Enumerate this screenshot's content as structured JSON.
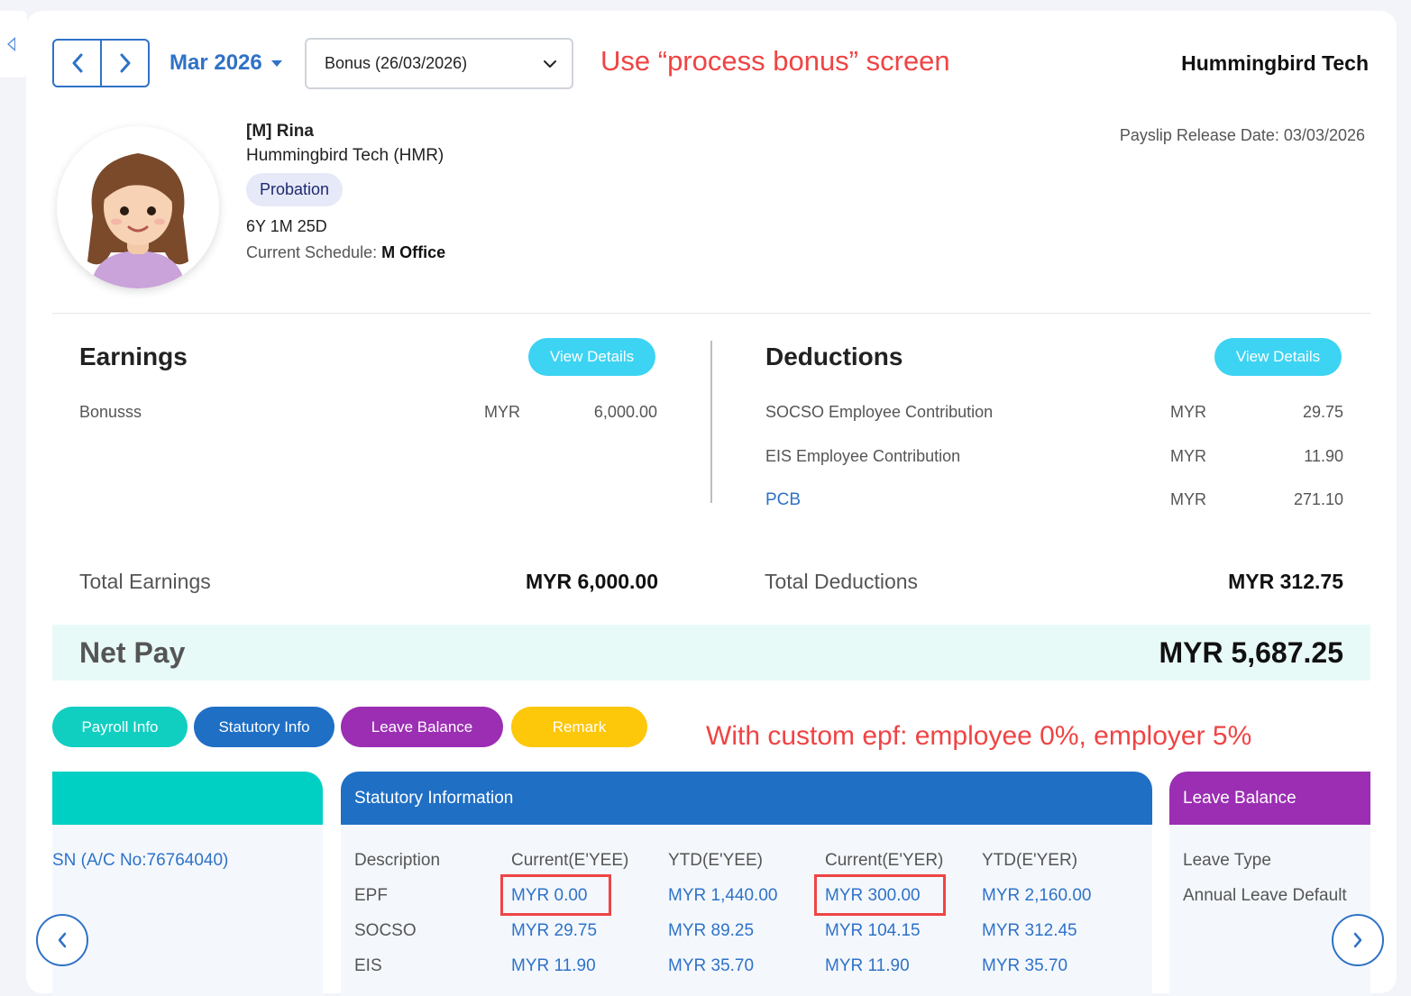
{
  "header": {
    "month_label": "Mar 2026",
    "payroll_select": "Bonus (26/03/2026)",
    "annotation": "Use “process bonus” screen",
    "company": "Hummingbird Tech"
  },
  "employee": {
    "name": "[M] Rina",
    "company": "Hummingbird Tech (HMR)",
    "status": "Probation",
    "tenure": "6Y 1M 25D",
    "schedule_label": "Current Schedule:",
    "schedule_value": "M Office",
    "release_date": "Payslip Release Date: 03/03/2026"
  },
  "earnings": {
    "title": "Earnings",
    "details_label": "View Details",
    "items": [
      {
        "label": "Bonusss",
        "currency": "MYR",
        "amount": "6,000.00"
      }
    ],
    "total_label": "Total Earnings",
    "total_value": "MYR 6,000.00"
  },
  "deductions": {
    "title": "Deductions",
    "details_label": "View Details",
    "items": [
      {
        "label": "SOCSO Employee Contribution",
        "currency": "MYR",
        "amount": "29.75"
      },
      {
        "label": "EIS Employee Contribution",
        "currency": "MYR",
        "amount": "11.90"
      },
      {
        "label": "PCB",
        "currency": "MYR",
        "amount": "271.10"
      }
    ],
    "total_label": "Total Deductions",
    "total_value": "MYR 312.75"
  },
  "netpay": {
    "label": "Net Pay",
    "value": "MYR 5,687.25"
  },
  "tabs": [
    {
      "label": "Payroll Info",
      "color": "#10cfc1"
    },
    {
      "label": "Statutory Info",
      "color": "#1f6fc5"
    },
    {
      "label": "Leave Balance",
      "color": "#9b2eb3"
    },
    {
      "label": "Remark",
      "color": "#fdc70a"
    }
  ],
  "annotation2": "With custom epf: employee 0%, employer 5%",
  "payroll_panel": {
    "account": "SN (A/C No:76764040)"
  },
  "statutory": {
    "title": "Statutory Information",
    "headers": [
      "Description",
      "Current(E'YEE)",
      "YTD(E'YEE)",
      "Current(E'YER)",
      "YTD(E'YER)"
    ],
    "rows": [
      [
        "EPF",
        "MYR 0.00",
        "MYR 1,440.00",
        "MYR 300.00",
        "MYR 2,160.00"
      ],
      [
        "SOCSO",
        "MYR 29.75",
        "MYR 89.25",
        "MYR 104.15",
        "MYR 312.45"
      ],
      [
        "EIS",
        "MYR 11.90",
        "MYR 35.70",
        "MYR 11.90",
        "MYR 35.70"
      ]
    ]
  },
  "leave": {
    "title": "Leave Balance",
    "type_header": "Leave Type",
    "items": [
      "Annual Leave Default"
    ]
  },
  "colors": {
    "primary": "#2f72c7",
    "cyan": "#3dd3f3",
    "annotation": "#ef4444"
  }
}
